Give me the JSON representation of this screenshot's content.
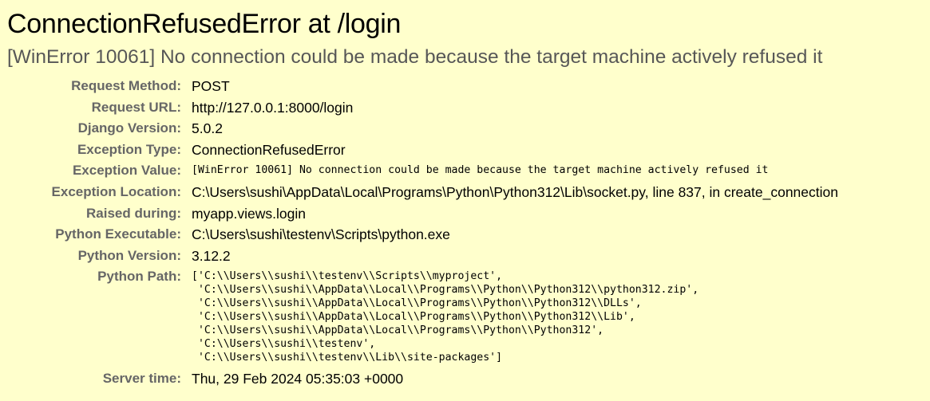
{
  "header": {
    "title": "ConnectionRefusedError at /login",
    "message": "[WinError 10061] No connection could be made because the target machine actively refused it"
  },
  "meta": {
    "request_method": {
      "label": "Request Method:",
      "value": "POST"
    },
    "request_url": {
      "label": "Request URL:",
      "value": "http://127.0.0.1:8000/login"
    },
    "django_version": {
      "label": "Django Version:",
      "value": "5.0.2"
    },
    "exception_type": {
      "label": "Exception Type:",
      "value": "ConnectionRefusedError"
    },
    "exception_value": {
      "label": "Exception Value:",
      "value": "[WinError 10061] No connection could be made because the target machine actively refused it"
    },
    "exception_location": {
      "label": "Exception Location:",
      "value": "C:\\Users\\sushi\\AppData\\Local\\Programs\\Python\\Python312\\Lib\\socket.py, line 837, in create_connection"
    },
    "raised_during": {
      "label": "Raised during:",
      "value": "myapp.views.login"
    },
    "python_executable": {
      "label": "Python Executable:",
      "value": "C:\\Users\\sushi\\testenv\\Scripts\\python.exe"
    },
    "python_version": {
      "label": "Python Version:",
      "value": "3.12.2"
    },
    "python_path": {
      "label": "Python Path:",
      "value": "['C:\\\\Users\\\\sushi\\\\testenv\\\\Scripts\\\\myproject',\n 'C:\\\\Users\\\\sushi\\\\AppData\\\\Local\\\\Programs\\\\Python\\\\Python312\\\\python312.zip',\n 'C:\\\\Users\\\\sushi\\\\AppData\\\\Local\\\\Programs\\\\Python\\\\Python312\\\\DLLs',\n 'C:\\\\Users\\\\sushi\\\\AppData\\\\Local\\\\Programs\\\\Python\\\\Python312\\\\Lib',\n 'C:\\\\Users\\\\sushi\\\\AppData\\\\Local\\\\Programs\\\\Python\\\\Python312',\n 'C:\\\\Users\\\\sushi\\\\testenv',\n 'C:\\\\Users\\\\sushi\\\\testenv\\\\Lib\\\\site-packages']"
    },
    "server_time": {
      "label": "Server time:",
      "value": "Thu, 29 Feb 2024 05:35:03 +0000"
    }
  },
  "colors": {
    "background": "#ffffcc",
    "label": "#666666",
    "message": "#575757"
  }
}
